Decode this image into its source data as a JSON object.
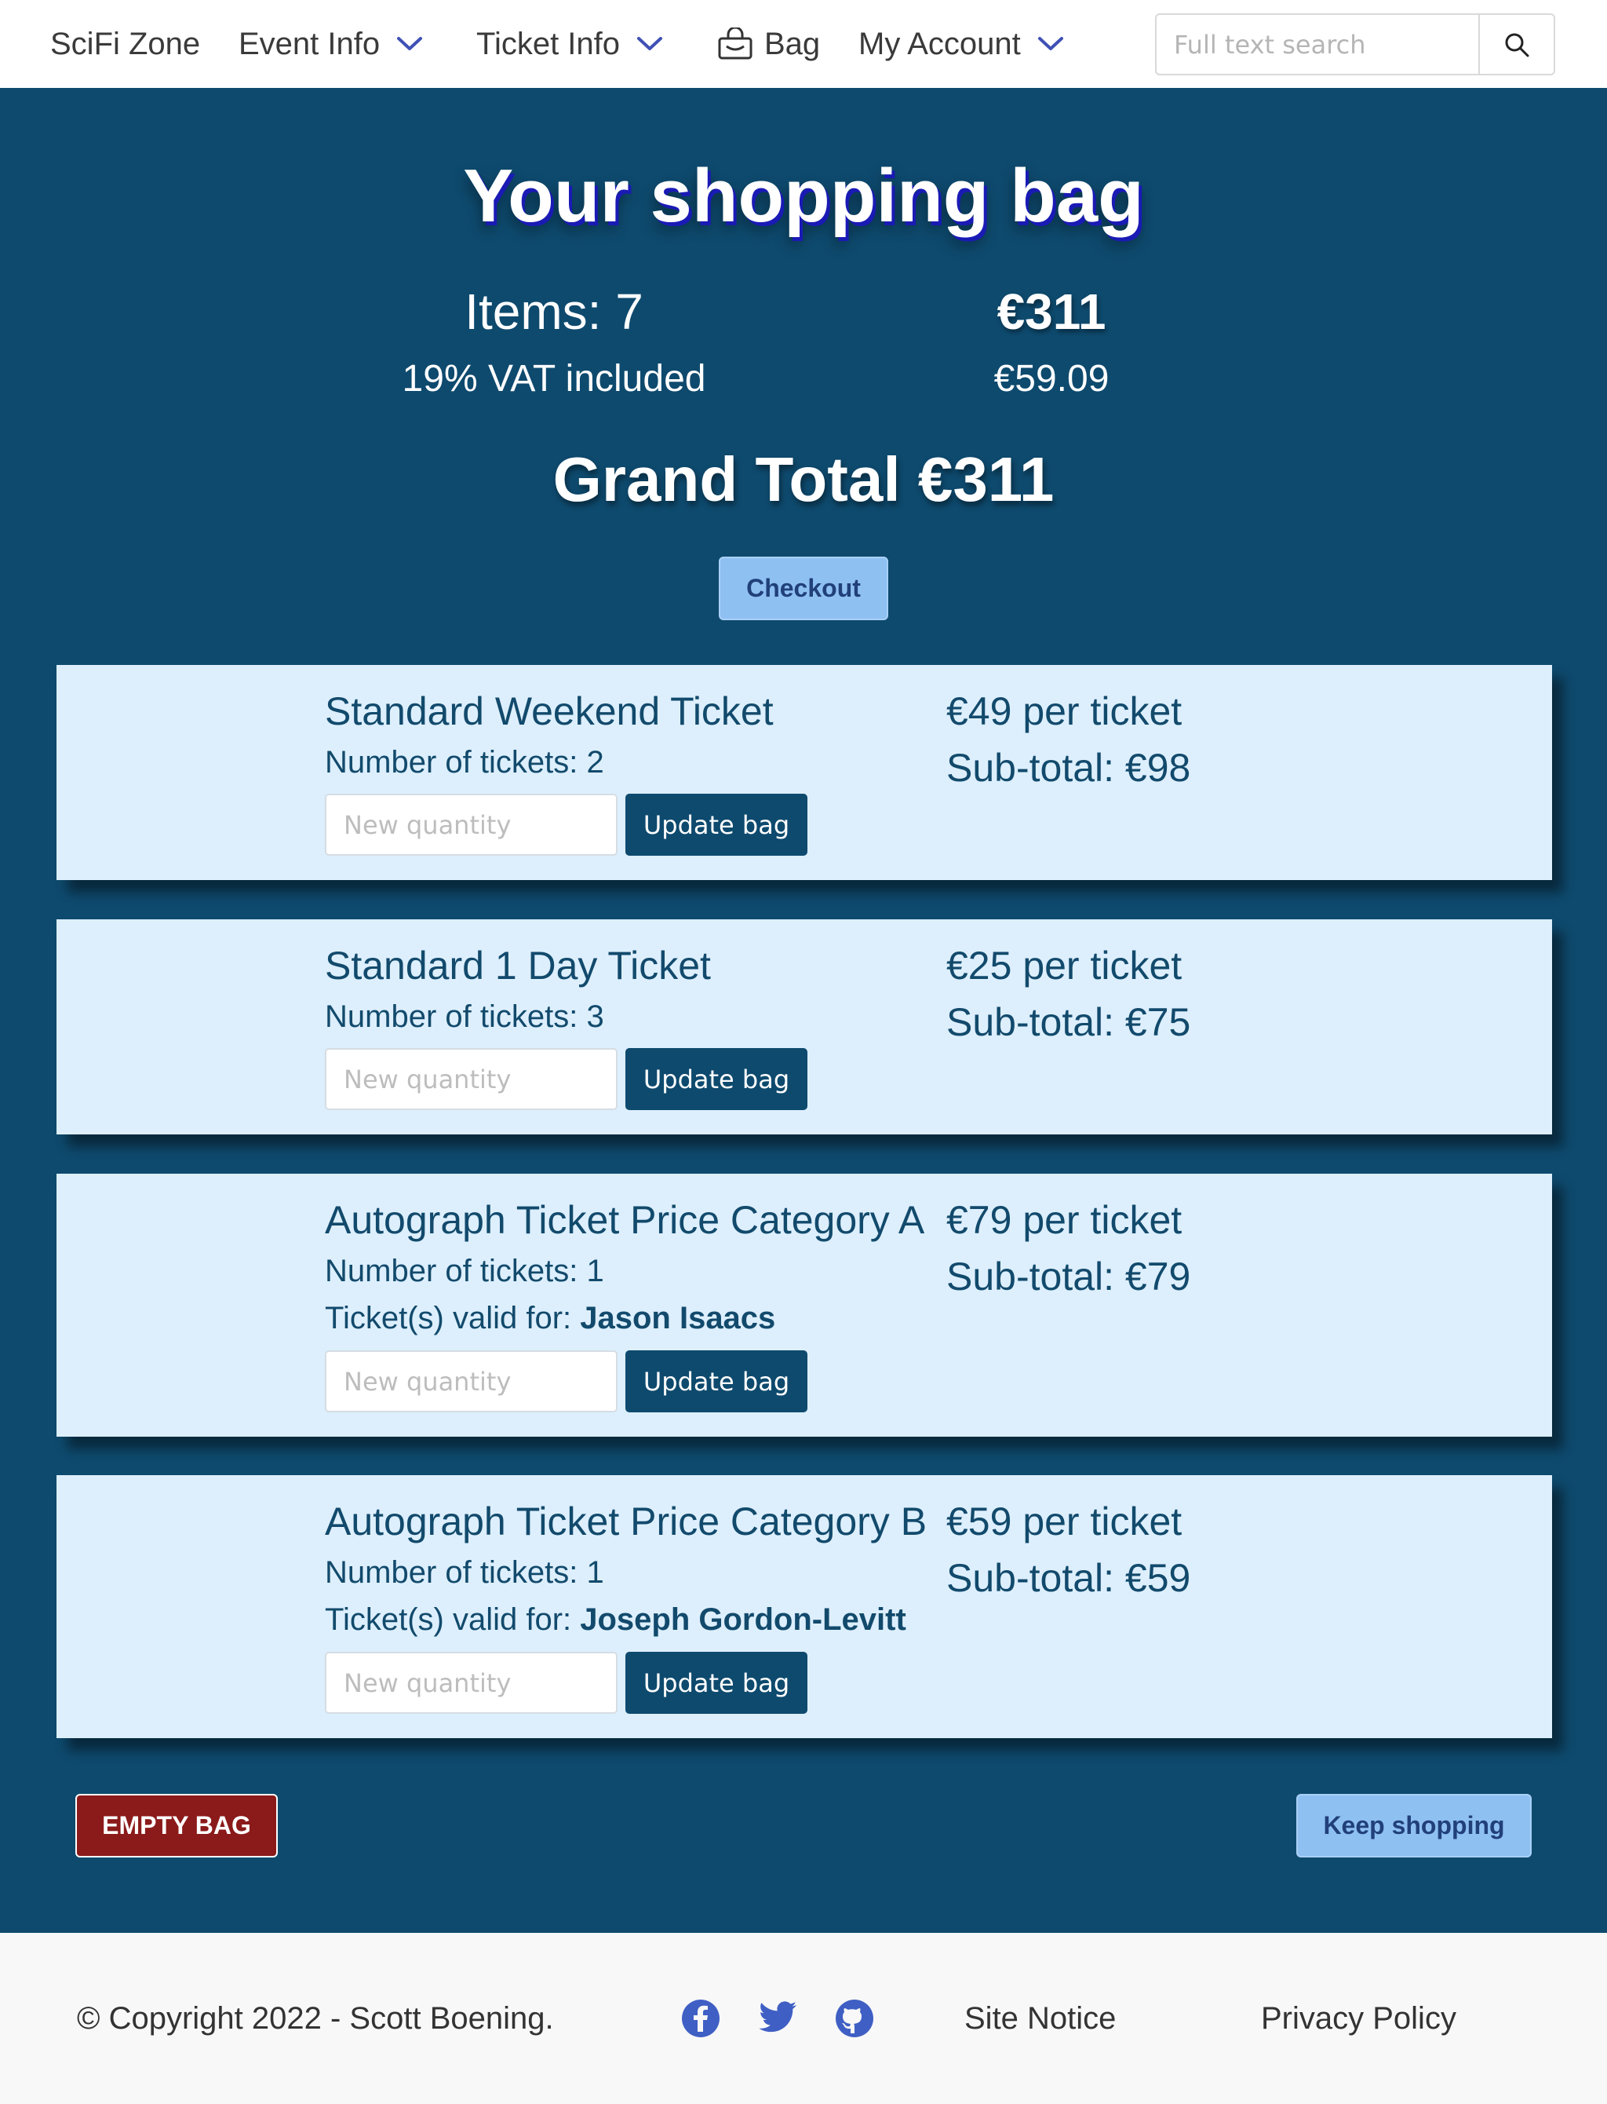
{
  "nav": {
    "brand": "SciFi Zone",
    "event_info": "Event Info",
    "ticket_info": "Ticket Info",
    "bag": "Bag",
    "my_account": "My Account",
    "search_placeholder": "Full text search",
    "icons": {
      "dropdown": "chevron-down-icon",
      "bag": "shopping-bag-icon",
      "search": "search-icon"
    },
    "chevron_color": "#3f51b5"
  },
  "header": {
    "title": "Your shopping bag",
    "items_label": "Items: 7",
    "total": "€311",
    "vat_label": "19% VAT included",
    "vat_amount": "€59.09",
    "grand_total": "Grand Total €311",
    "checkout": "Checkout"
  },
  "items": [
    {
      "name": "Standard Weekend Ticket",
      "count": "Number of tickets: 2",
      "price": "€49 per ticket",
      "subtotal": "Sub-total: €98",
      "qty_placeholder": "New quantity",
      "update": "Update bag"
    },
    {
      "name": "Standard 1 Day Ticket",
      "count": "Number of tickets: 3",
      "price": "€25 per ticket",
      "subtotal": "Sub-total: €75",
      "qty_placeholder": "New quantity",
      "update": "Update bag"
    },
    {
      "name": "Autograph Ticket Price Category A",
      "count": "Number of tickets: 1",
      "valid_label": "Ticket(s) valid for: ",
      "valid_for": "Jason Isaacs",
      "price": "€79 per ticket",
      "subtotal": "Sub-total: €79",
      "qty_placeholder": "New quantity",
      "update": "Update bag"
    },
    {
      "name": "Autograph Ticket Price Category B",
      "count": "Number of tickets: 1",
      "valid_label": "Ticket(s) valid for: ",
      "valid_for": "Joseph Gordon-Levitt",
      "price": "€59 per ticket",
      "subtotal": "Sub-total: €59",
      "qty_placeholder": "New quantity",
      "update": "Update bag"
    }
  ],
  "actions": {
    "empty": "EMPTY BAG",
    "keep": "Keep shopping"
  },
  "footer": {
    "copyright": "© Copyright 2022 - Scott Boening.",
    "site_notice": "Site Notice",
    "privacy": "Privacy Policy",
    "icons": [
      "facebook-icon",
      "twitter-icon",
      "github-icon"
    ],
    "icon_color": "#3f5fc4"
  },
  "colors": {
    "page_bg": "#0e4a6e",
    "card_bg": "#ddeffd",
    "accent_button": "#8fc0f2",
    "danger_button": "#8b1a1a"
  }
}
